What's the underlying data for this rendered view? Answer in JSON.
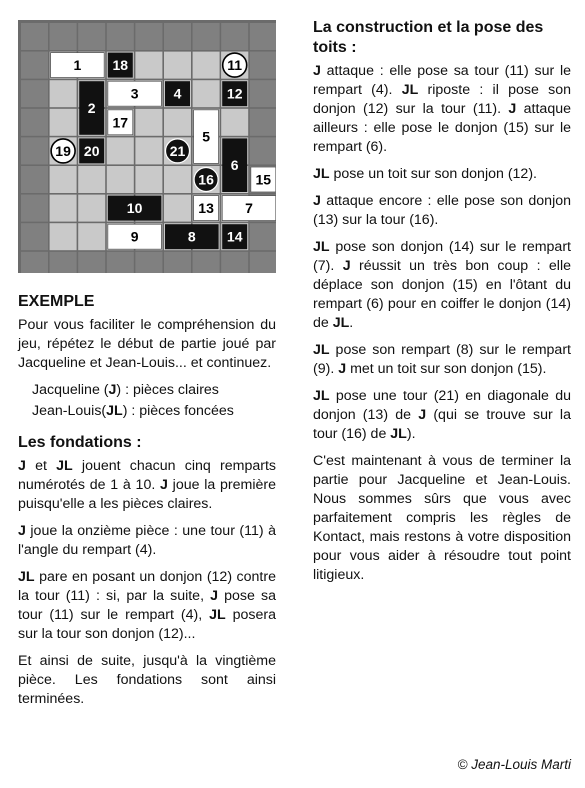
{
  "board": {
    "pieces": [
      {
        "label": "1",
        "tone": "light"
      },
      {
        "label": "18",
        "tone": "dark"
      },
      {
        "label": "11",
        "tone": "light-round"
      },
      {
        "label": "2",
        "tone": "dark"
      },
      {
        "label": "3",
        "tone": "light"
      },
      {
        "label": "4",
        "tone": "dark"
      },
      {
        "label": "12",
        "tone": "dark"
      },
      {
        "label": "17",
        "tone": "light"
      },
      {
        "label": "5",
        "tone": "light"
      },
      {
        "label": "19",
        "tone": "light-round"
      },
      {
        "label": "20",
        "tone": "dark"
      },
      {
        "label": "21",
        "tone": "dark-round"
      },
      {
        "label": "6",
        "tone": "dark"
      },
      {
        "label": "16",
        "tone": "dark-round"
      },
      {
        "label": "15",
        "tone": "light"
      },
      {
        "label": "10",
        "tone": "dark"
      },
      {
        "label": "13",
        "tone": "light"
      },
      {
        "label": "7",
        "tone": "light"
      },
      {
        "label": "9",
        "tone": "light"
      },
      {
        "label": "8",
        "tone": "dark"
      },
      {
        "label": "14",
        "tone": "dark"
      }
    ]
  },
  "left": {
    "example_title": "EXEMPLE",
    "intro": "Pour vous faciliter le compréhension du jeu, répétez le début de partie joué par Jacqueline et Jean-Louis... et continuez.",
    "legend_j": "Jacqueline (J) :  pièces claires",
    "legend_jl": "Jean-Louis(JL) : pièces foncées",
    "fondations_title": "Les fondations :",
    "p1": "J et JL jouent chacun cinq remparts numérotés de 1 à 10. J joue la première puisqu'elle a les pièces claires.",
    "p2": "J joue la onzième pièce : une tour (11) à l'angle du rempart (4).",
    "p3": "JL pare en posant un donjon (12) contre la tour (11) : si, par la suite, J pose sa tour (11) sur le rempart (4), JL posera sur la tour son donjon (12)...",
    "p4": "Et ainsi de suite, jusqu'à la vingtième pièce. Les fondations sont ainsi terminées."
  },
  "right": {
    "title": "La construction et la pose des toits :",
    "p1": "J attaque : elle pose sa tour (11) sur le rempart (4). JL riposte : il pose son donjon (12) sur la tour (11). J attaque ailleurs : elle pose le donjon (15) sur le rempart (6).",
    "p2": "JL pose un toit sur son donjon (12).",
    "p3": "J attaque encore : elle pose son donjon (13) sur la tour (16).",
    "p4": "JL pose son donjon (14) sur le rempart (7). J réussit un très bon coup : elle déplace son donjon (15) en l'ôtant du rempart (6) pour en coiffer le donjon (14) de JL.",
    "p5": "JL pose son rempart (8) sur le rempart (9). J met un toit sur son donjon (15).",
    "p6": "JL pose une tour (21) en diagonale du donjon (13) de J (qui se trouve sur la tour (16) de JL).",
    "p7": "C'est maintenant à vous de terminer la partie pour Jacqueline et Jean-Louis. Nous sommes sûrs que vous avec parfaitement compris les règles de Kontact, mais restons à votre disposition pour vous aider à résoudre tout point litigieux."
  },
  "copyright": "© Jean-Louis Marti"
}
